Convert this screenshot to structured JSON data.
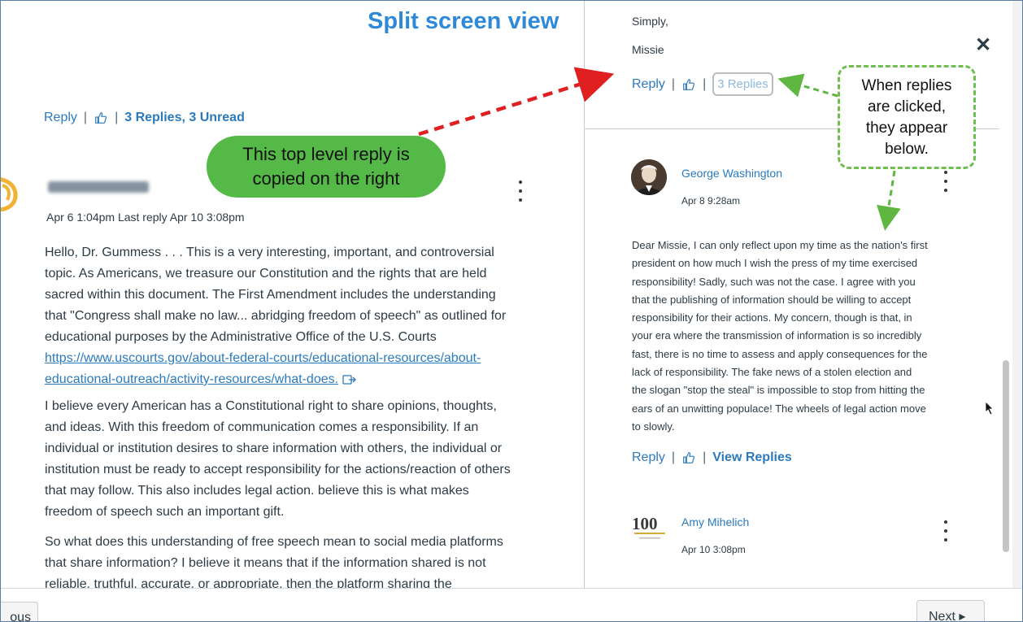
{
  "annotations": {
    "title": "Split screen view",
    "green_bubble_line1": "This top level reply is",
    "green_bubble_line2": "copied on the right",
    "dashed_line1": "When replies",
    "dashed_line2": "are clicked,",
    "dashed_line3": "they appear",
    "dashed_line4": "below."
  },
  "left": {
    "reply_label": "Reply",
    "separator": "|",
    "replies_label": "3 Replies, 3 Unread",
    "date": "Apr 6 1:04pm Last reply Apr 10 3:08pm",
    "p1_a": "Hello, Dr. Gummess . . . This is a very interesting, important, and controversial",
    "p1_b": "topic.  As Americans, we treasure our Constitution and the rights that are held",
    "p1_c": "sacred within this document.  The First Amendment includes the understanding",
    "p1_d": "that \"Congress shall make no law... abridging freedom of speech\" as outlined for",
    "p1_e": "educational purposes by the Administrative Office of the U.S. Courts",
    "link_a": "https://www.uscourts.gov/about-federal-courts/educational-resources/about-",
    "link_b": "educational-outreach/activity-resources/what-does.",
    "p2_a": "I believe every American has a Constitutional right to share opinions, thoughts,",
    "p2_b": "and ideas.  With this freedom of communication comes a responsibility.  If an",
    "p2_c": "individual or institution desires to share information with others, the individual or",
    "p2_d": "institution must be ready to accept responsibility for the actions/reaction of others",
    "p2_e": "that may follow. This also includes legal action.  believe this is what makes",
    "p2_f": "freedom of speech such an important gift.",
    "p3_a": "So what does this understanding of free speech mean to social media platforms",
    "p3_b": "that share information?  I believe it means that if the information shared is not",
    "p3_c": "reliable, truthful, accurate, or appropriate, then the platform sharing the"
  },
  "right": {
    "simply": "Simply,",
    "missie": "Missie",
    "reply_label": "Reply",
    "separator": "|",
    "replies_button": "3 Replies",
    "reply1": {
      "author": "George Washington",
      "date": "Apr 8 9:28am",
      "lines": [
        "Dear Missie, I can only reflect upon my time as the nation's first",
        "president on how much I wish the press of my time exercised",
        "responsibility!  Sadly, such was not the case.  I agree with you",
        "that the publishing of information should be willing to accept",
        "responsibility for their actions.  My concern, though is that, in",
        "your era where the transmission of information is so incredibly",
        "fast, there is no time to assess and apply consequences for the",
        "lack of responsibility.  The fake news of a stolen election and",
        "the slogan \"stop the steal\" is impossible to stop from hitting the",
        "ears of an unwitting populace!  The wheels of legal action move",
        "to slowly."
      ],
      "reply_label": "Reply",
      "view_replies": "View Replies"
    },
    "reply2": {
      "author": "Amy Mihelich",
      "date": "Apr 10 3:08pm",
      "logo_text": "100"
    }
  },
  "close_glyph": "✕",
  "nav": {
    "previous_visible": "ous",
    "next": "Next ▸"
  },
  "colors": {
    "link": "#2b7abc",
    "title_annotation": "#2e8ad9",
    "green_bubble": "#55b947",
    "dashed_border": "#6fbf50",
    "red_arrow": "#e02020"
  }
}
